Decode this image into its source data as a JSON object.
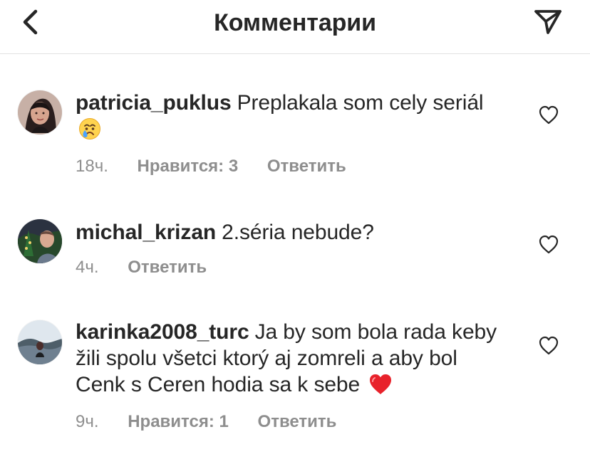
{
  "header": {
    "title": "Комментарии",
    "back_icon": "chevron-left-icon",
    "send_icon": "paper-plane-icon"
  },
  "comments": [
    {
      "username": "patricia_puklus",
      "text": "Preplakala som cely seriál",
      "emoji": "crying-face-emoji",
      "time": "18ч.",
      "likes": "Нравится: 3",
      "reply": "Ответить"
    },
    {
      "username": "michal_krizan",
      "text": "2.séria nebude?",
      "time": "4ч.",
      "reply": "Ответить"
    },
    {
      "username": "karinka2008_turc",
      "text": "Ja by som bola rada keby žili spolu všetci ktorý aj zomreli a aby bol Cenk s Ceren hodia sa k sebe",
      "emoji": "red-heart-emoji",
      "time": "9ч.",
      "likes": "Нравится: 1",
      "reply": "Ответить"
    }
  ],
  "colors": {
    "primary_text": "#262626",
    "secondary_text": "#8e8e8e",
    "divider": "#e2e2e2",
    "heart_red": "#e8222b"
  }
}
